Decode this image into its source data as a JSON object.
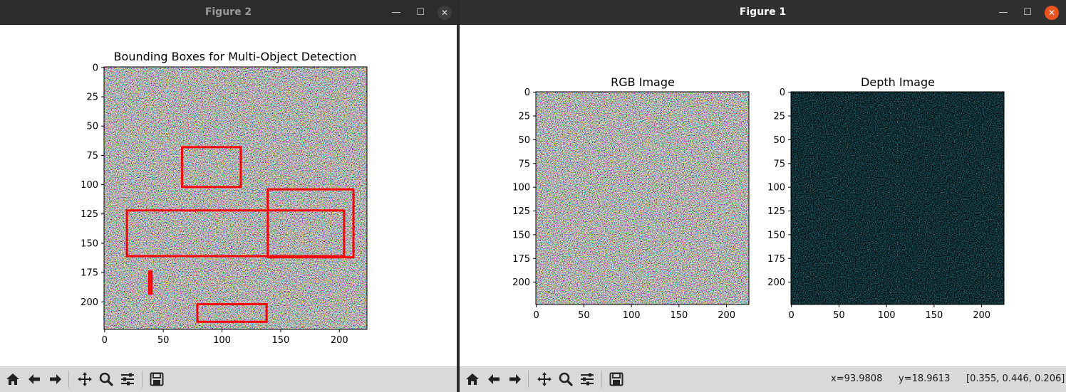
{
  "windows": {
    "figure2": {
      "title": "Figure 2",
      "axes_title": "Bounding Boxes for Multi-Object Detection",
      "xticks": [
        "0",
        "50",
        "100",
        "150",
        "200"
      ],
      "yticks": [
        "0",
        "25",
        "50",
        "75",
        "100",
        "125",
        "150",
        "175",
        "200"
      ],
      "boxes": [
        {
          "x1": 66,
          "y1": 68,
          "x2": 116,
          "y2": 102
        },
        {
          "x1": 139,
          "y1": 104,
          "x2": 212,
          "y2": 162
        },
        {
          "x1": 19,
          "y1": 122,
          "x2": 204,
          "y2": 161
        },
        {
          "x1": 38,
          "y1": 174,
          "x2": 40,
          "y2": 193
        },
        {
          "x1": 79,
          "y1": 202,
          "x2": 138,
          "y2": 217
        }
      ]
    },
    "figure1": {
      "title": "Figure 1",
      "subplots": [
        {
          "title": "RGB Image",
          "xticks": [
            "0",
            "50",
            "100",
            "150",
            "200"
          ],
          "yticks": [
            "0",
            "25",
            "50",
            "75",
            "100",
            "125",
            "150",
            "175",
            "200"
          ]
        },
        {
          "title": "Depth Image",
          "xticks": [
            "0",
            "50",
            "100",
            "150",
            "200"
          ],
          "yticks": [
            "0",
            "25",
            "50",
            "75",
            "100",
            "125",
            "150",
            "175",
            "200"
          ]
        }
      ],
      "status": {
        "x": "x=93.9808",
        "y": "y=18.9613",
        "value": "[0.355, 0.446, 0.206]"
      }
    }
  },
  "toolbar_icons": [
    "home-icon",
    "back-arrow-icon",
    "forward-arrow-icon",
    "pan-icon",
    "zoom-icon",
    "configure-subplots-icon",
    "save-icon"
  ],
  "window_controls": {
    "minimize": "—",
    "maximize": "☐",
    "close": "✕"
  },
  "colors": {
    "box": "#ff0000",
    "close_active": "#e95420"
  }
}
